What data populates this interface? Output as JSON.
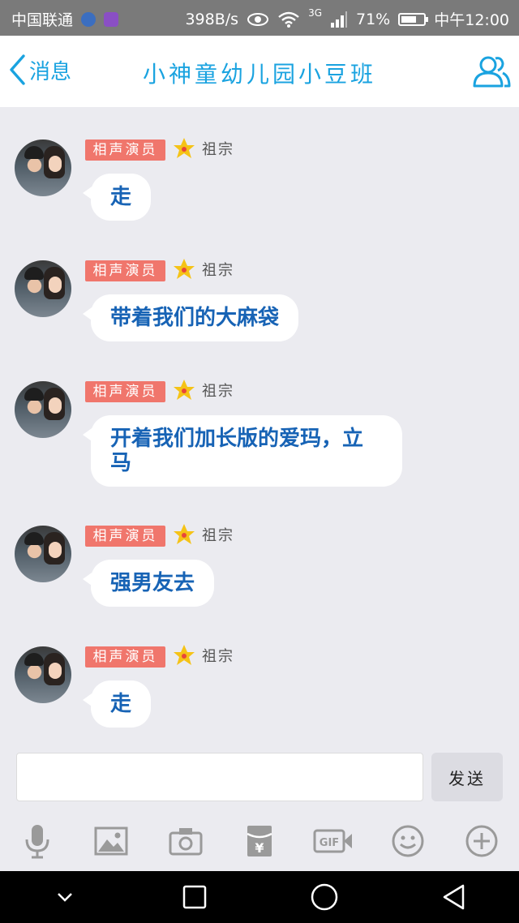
{
  "status_bar": {
    "carrier": "中国联通",
    "speed": "398B/s",
    "network": "3G",
    "battery": "71%",
    "battery_level": 0.71,
    "time": "中午12:00"
  },
  "header": {
    "back_label": "消息",
    "title": "小神童幼儿园小豆班"
  },
  "messages": [
    {
      "badge": "相声演员",
      "nickname": "祖宗",
      "text": "走"
    },
    {
      "badge": "相声演员",
      "nickname": "祖宗",
      "text": "带着我们的大麻袋"
    },
    {
      "badge": "相声演员",
      "nickname": "祖宗",
      "text": "开着我们加长版的爱玛，立马"
    },
    {
      "badge": "相声演员",
      "nickname": "祖宗",
      "text": "强男友去"
    },
    {
      "badge": "相声演员",
      "nickname": "祖宗",
      "text": "走"
    }
  ],
  "input": {
    "value": "",
    "placeholder": "",
    "send_label": "发送"
  },
  "toolbar": {
    "items": [
      "mic-icon",
      "image-icon",
      "camera-icon",
      "red-packet-icon",
      "gif-icon",
      "emoji-icon",
      "plus-icon"
    ],
    "gif_label": "GIF",
    "red_packet_label": "¥"
  },
  "colors": {
    "accent": "#1aa3e0",
    "bubble_text": "#1763b5",
    "badge_bg": "#f0766c",
    "background": "#ebebf0"
  }
}
